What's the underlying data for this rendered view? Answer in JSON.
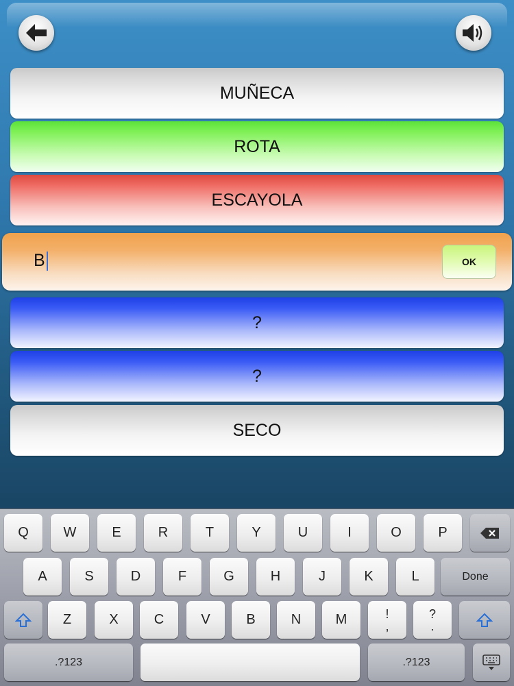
{
  "header": {
    "back_icon": "back-arrow-icon",
    "sound_icon": "speaker-icon"
  },
  "words": [
    {
      "label": "MUÑECA",
      "state": "neutral"
    },
    {
      "label": "ROTA",
      "state": "correct"
    },
    {
      "label": "ESCAYOLA",
      "state": "wrong"
    }
  ],
  "answer": {
    "value": "B",
    "ok_label": "OK"
  },
  "hidden_words": [
    {
      "label": "?"
    },
    {
      "label": "?"
    }
  ],
  "last_word": {
    "label": "SECO"
  },
  "keyboard": {
    "row1": [
      "Q",
      "W",
      "E",
      "R",
      "T",
      "Y",
      "U",
      "I",
      "O",
      "P"
    ],
    "row2": [
      "A",
      "S",
      "D",
      "F",
      "G",
      "H",
      "J",
      "K",
      "L"
    ],
    "row3": [
      "Z",
      "X",
      "C",
      "V",
      "B",
      "N",
      "M"
    ],
    "done_label": "Done",
    "numbers_label": ".?123",
    "excl_top": "!",
    "excl_bottom": ",",
    "quest_top": "?",
    "quest_bottom": "."
  },
  "colors": {
    "neutral": "#eeeeee",
    "correct": "#7ef055",
    "wrong": "#ee6a62",
    "answer": "#f3b06a",
    "hidden": "#3b5cf5",
    "ok": "#c9f57c"
  }
}
